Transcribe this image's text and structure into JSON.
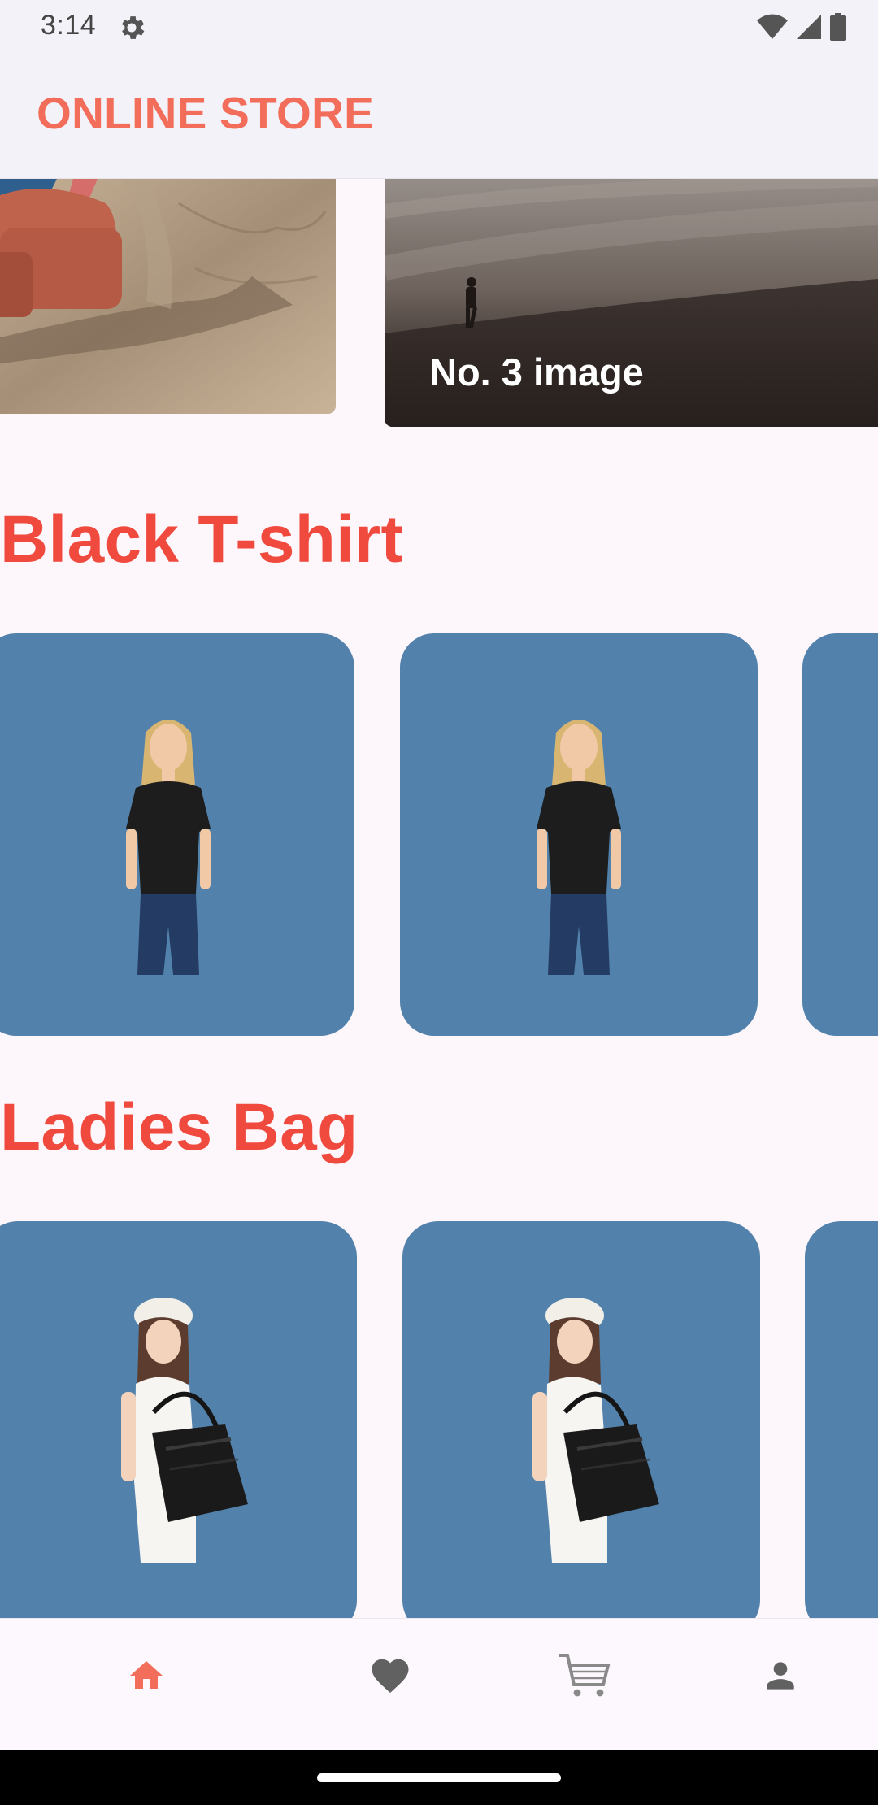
{
  "status_bar": {
    "time": "3:14",
    "icons": [
      "settings-gear-icon",
      "wifi-icon",
      "cellular-signal-icon",
      "battery-icon"
    ]
  },
  "app_bar": {
    "title": "ONLINE STORE"
  },
  "carousel": {
    "items": [
      {
        "id": "beach-armchair",
        "caption": ""
      },
      {
        "id": "foggy-hill",
        "caption": "No. 3 image"
      }
    ]
  },
  "sections": [
    {
      "title": "Black T-shirt",
      "product_image": "woman-black-tshirt",
      "card_count_visible": 3
    },
    {
      "title": "Ladies Bag",
      "product_image": "woman-black-handbag",
      "card_count_visible": 3
    }
  ],
  "bottom_nav": {
    "items": [
      {
        "name": "home",
        "icon": "home-icon",
        "active": true
      },
      {
        "name": "favorites",
        "icon": "heart-icon",
        "active": false
      },
      {
        "name": "cart",
        "icon": "cart-icon",
        "active": false
      },
      {
        "name": "profile",
        "icon": "person-icon",
        "active": false
      }
    ]
  },
  "colors": {
    "accent": "#f36d5b",
    "section_title": "#f04a3f",
    "card_background": "#5282ab",
    "nav_inactive": "#616161",
    "app_bar_background": "#f3f2f8",
    "page_background": "#fdf7fc"
  }
}
